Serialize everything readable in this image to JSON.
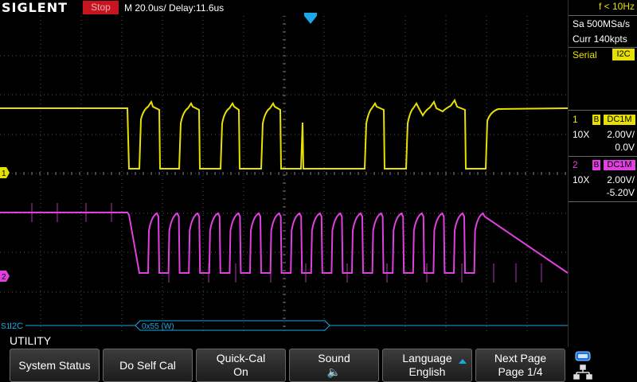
{
  "header": {
    "brand": "SIGLENT",
    "status": "Stop",
    "timebase": "M 20.0us/  Delay:11.6us"
  },
  "right_panel": {
    "trigger_freq": "f < 10Hz",
    "sample_rate": "Sa 500MSa/s",
    "memory": "Curr 140kpts",
    "decode_label": "Serial",
    "decode_protocol": "I2C",
    "channels": [
      {
        "num": "1",
        "b": "B",
        "coupling": "DC1M",
        "probe": "10X",
        "scale": "2.00V/",
        "offset": "0.0V",
        "color": "#e8e000"
      },
      {
        "num": "2",
        "b": "B",
        "coupling": "DC1M",
        "probe": "10X",
        "scale": "2.00V/",
        "offset": "-5.20V",
        "color": "#e040e0"
      }
    ]
  },
  "waveform": {
    "ch1_marker": "1",
    "ch2_marker": "2",
    "decode_marker": "S1",
    "decode_bus_label": "I2C",
    "decode_packet": "0x55 (W)"
  },
  "menu": {
    "title": "UTILITY",
    "softkeys": [
      {
        "l1": "System Status",
        "l2": ""
      },
      {
        "l1": "Do Self Cal",
        "l2": ""
      },
      {
        "l1": "Quick-Cal",
        "l2": "On"
      },
      {
        "l1": "Sound",
        "l2": "🔈"
      },
      {
        "l1": "Language",
        "l2": "English"
      },
      {
        "l1": "Next Page",
        "l2": "Page 1/4"
      }
    ]
  },
  "colors": {
    "ch1": "#e8e000",
    "ch2": "#e040e0",
    "decode": "#1aa8e6",
    "stop": "#c8141e"
  }
}
